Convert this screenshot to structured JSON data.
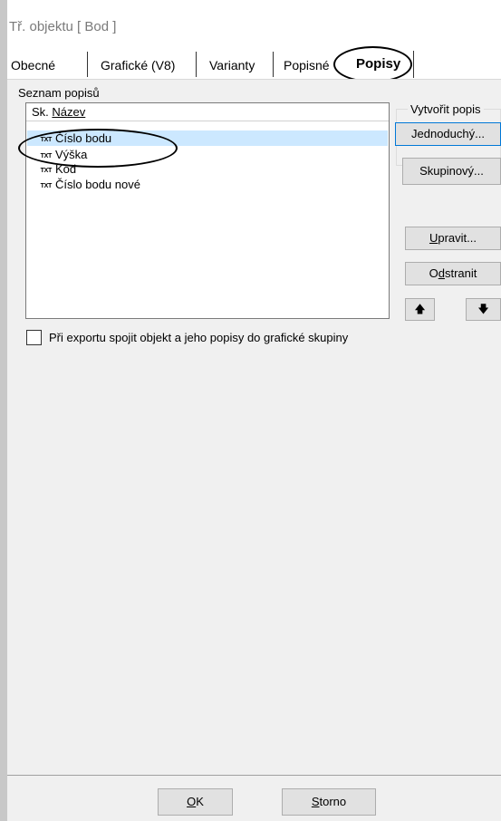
{
  "window": {
    "title": "Tř. objektu [ Bod ]"
  },
  "tabs": [
    {
      "label": "Obecné"
    },
    {
      "label": "Grafické (V8)"
    },
    {
      "label": "Varianty"
    },
    {
      "label": "Popisné"
    },
    {
      "label": "Popisy",
      "active": true
    }
  ],
  "labels_list": {
    "group_label": "Seznam popisů",
    "header_prefix": "Sk.",
    "header_name": "Název",
    "items": [
      {
        "icon": "TXT",
        "name": "Číslo bodu",
        "selected": true
      },
      {
        "icon": "TXT",
        "name": "Výška"
      },
      {
        "icon": "TXT",
        "name": "Kód"
      },
      {
        "icon": "TXT",
        "name": "Číslo bodu nové"
      }
    ]
  },
  "create_group": {
    "legend": "Vytvořit popis",
    "simple_button": "Jednoduchý...",
    "group_button": "Skupinový..."
  },
  "buttons": {
    "edit_mnemonic": "U",
    "edit_rest": "pravit...",
    "delete_pre": "O",
    "delete_mnemonic": "d",
    "delete_rest": "stranit",
    "up_arrow": "🡅",
    "down_arrow": "🡇"
  },
  "checkbox": {
    "checked": false,
    "label": "Při exportu spojit objekt a jeho popisy do grafické skupiny"
  },
  "footer": {
    "ok_mnemonic": "O",
    "ok_rest": "K",
    "cancel_mnemonic": "S",
    "cancel_rest": "torno"
  },
  "colors": {
    "selection": "#cce8ff",
    "panel": "#f0f0f0",
    "button_face": "#e1e1e1",
    "focus_border": "#0078d7"
  }
}
